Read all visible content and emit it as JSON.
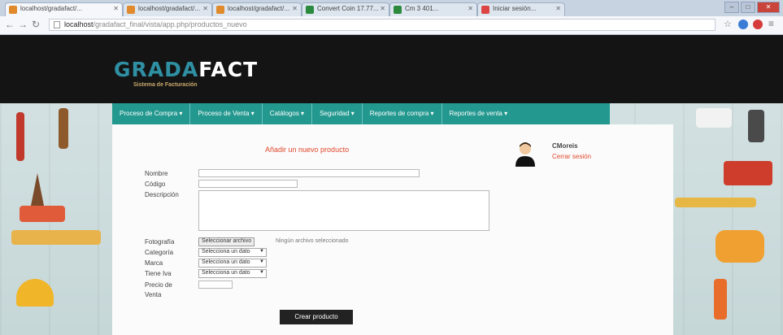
{
  "browser": {
    "tabs": [
      {
        "title": "localhost/gradafact/..."
      },
      {
        "title": "localhost/gradafact/..."
      },
      {
        "title": "localhost/gradafact/..."
      },
      {
        "title": "Convert Coin 17.77..."
      },
      {
        "title": "Cm 3 401..."
      },
      {
        "title": "Iniciar sesión..."
      }
    ],
    "url_host": "localhost",
    "url_path": "/gradafact_final/vista/app.php/productos_nuevo"
  },
  "header": {
    "logo_part1": "GRADA",
    "logo_part2": "FACT",
    "tagline": "Sistema de Facturación"
  },
  "menu": [
    {
      "label": "Proceso de Compra ▾"
    },
    {
      "label": "Proceso de Venta ▾"
    },
    {
      "label": "Catálogos ▾"
    },
    {
      "label": "Seguridad ▾"
    },
    {
      "label": "Reportes de compra ▾"
    },
    {
      "label": "Reportes de venta ▾"
    }
  ],
  "form": {
    "title": "Añadir un nuevo producto",
    "labels": {
      "nombre": "Nombre",
      "codigo": "Código",
      "descripcion": "Descripción",
      "fotografia": "Fotografía",
      "categoria": "Categoría",
      "marca": "Marca",
      "tiene_iva": "Tiene Iva",
      "precio_line1": "Precio de",
      "precio_line2": "Venta"
    },
    "file_button": "Seleccionar archivo",
    "file_status": "Ningún archivo seleccionado",
    "select_placeholder": "Selecciona un dato",
    "submit": "Crear producto"
  },
  "user": {
    "name": "CMoreis",
    "logout": "Cerrar sesión"
  }
}
